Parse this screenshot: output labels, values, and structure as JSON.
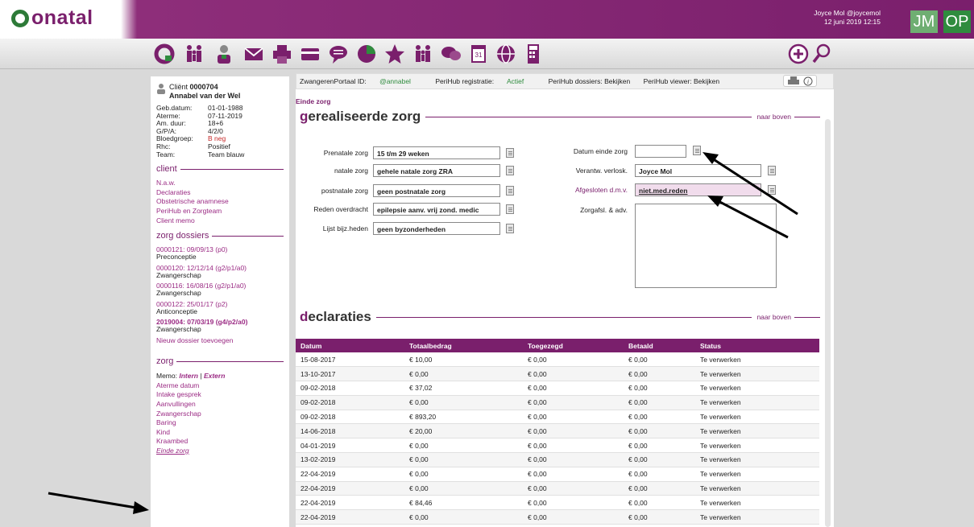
{
  "app": {
    "logo": "onatal",
    "user_line1": "Joyce Mol @joycemol",
    "user_line2": "12 juni 2019 12:15",
    "initials1": "JM",
    "initials2": "OP"
  },
  "toolbar": {
    "icons": [
      "onatal-icon",
      "family-icon",
      "person-icon",
      "mail-icon",
      "print-icon",
      "card-icon",
      "speech-bubble-icon",
      "pie-chart-icon",
      "star-icon",
      "family-icon",
      "chat-icon",
      "calendar-icon",
      "globe-icon",
      "calculator-icon"
    ],
    "add_icon": "plus-circle-icon",
    "search_icon": "search-icon"
  },
  "client": {
    "label": "Cliënt",
    "number": "0000704",
    "name": "Annabel van der Wel",
    "info": [
      [
        "Geb.datum:",
        "01-01-1988"
      ],
      [
        "Aterme:",
        "07-11-2019"
      ],
      [
        "Am. duur:",
        "18+6"
      ],
      [
        "G/P/A:",
        "4/2/0"
      ],
      [
        "Bloedgroep:",
        "B neg"
      ],
      [
        "Rhc:",
        "Positief"
      ],
      [
        "Team:",
        "Team blauw"
      ]
    ]
  },
  "sections": {
    "client": {
      "title": "client",
      "links": [
        "N.a.w.",
        "Declaraties",
        "Obstetrische anamnese",
        "PeriHub en Zorgteam",
        "Client memo"
      ]
    },
    "dossiers": {
      "title": "zorg dossiers",
      "items": [
        {
          "link": "0000121: 09/09/13 (p0)",
          "sub": "Preconceptie",
          "bold": false
        },
        {
          "link": "0000120: 12/12/14 (g2/p1/a0)",
          "sub": "Zwangerschap",
          "bold": false
        },
        {
          "link": "0000116: 16/08/16 (g2/p1/a0)",
          "sub": "Zwangerschap",
          "bold": false
        },
        {
          "link": "0000122: 25/01/17 (p2)",
          "sub": "Anticonceptie",
          "bold": false
        },
        {
          "link": "2019004: 07/03/19 (g4/p2/a0)",
          "sub": "Zwangerschap",
          "bold": true
        }
      ],
      "new": "Nieuw dossier toevoegen"
    },
    "zorg": {
      "title": "zorg",
      "memo_label": "Memo:",
      "memo_intern": "Intern",
      "memo_sep": "|",
      "memo_extern": "Extern",
      "links": [
        "Aterme datum",
        "Intake gesprek",
        "Aanvullingen",
        "Zwangerschap",
        "Baring",
        "Kind",
        "Kraambed",
        "Einde zorg"
      ]
    }
  },
  "main": {
    "hdr": {
      "portal_label": "ZwangerenPortaal ID:",
      "portal_value": "@annabel",
      "reg_label": "PeriHub registratie:",
      "reg_value": "Actief",
      "dossiers": "PeriHub dossiers: Bekijken",
      "viewer": "PeriHub viewer: Bekijken"
    },
    "breadcrumb": "Einde zorg",
    "title_first": "g",
    "title_rest": "erealiseerde zorg",
    "naar_boven": "naar boven",
    "fields": {
      "prenatal_label": "Prenatale zorg",
      "prenatal_value": "15 t/m 29 weken",
      "natal_label": "natale zorg",
      "natal_value": "gehele natale zorg ZRA",
      "postnatal_label": "postnatale zorg",
      "postnatal_value": "geen postnatale zorg",
      "reden_label": "Reden overdracht",
      "reden_value": "epilepsie aanv. vrij zond. medic",
      "lijst_label": "Lijst bijz.heden",
      "lijst_value": "geen byzonderheden",
      "datum_label": "Datum einde zorg",
      "datum_value": "",
      "verantw_label": "Verantw. verlosk.",
      "verantw_value": "Joyce Mol",
      "afgesloten_label": "Afgesloten d.m.v.",
      "afgesloten_value": "niet.med.reden",
      "zorgafsl_label": "Zorgafsl. & adv."
    },
    "decl_first": "d",
    "decl_rest": "eclaraties",
    "table": {
      "headers": [
        "Datum",
        "Totaalbedrag",
        "Toegezegd",
        "Betaald",
        "Status"
      ],
      "rows": [
        [
          "15-08-2017",
          "€ 10,00",
          "€ 0,00",
          "€ 0,00",
          "Te verwerken"
        ],
        [
          "13-10-2017",
          "€ 0,00",
          "€ 0,00",
          "€ 0,00",
          "Te verwerken"
        ],
        [
          "09-02-2018",
          "€ 37,02",
          "€ 0,00",
          "€ 0,00",
          "Te verwerken"
        ],
        [
          "09-02-2018",
          "€ 0,00",
          "€ 0,00",
          "€ 0,00",
          "Te verwerken"
        ],
        [
          "09-02-2018",
          "€ 893,20",
          "€ 0,00",
          "€ 0,00",
          "Te verwerken"
        ],
        [
          "14-06-2018",
          "€ 20,00",
          "€ 0,00",
          "€ 0,00",
          "Te verwerken"
        ],
        [
          "04-01-2019",
          "€ 0,00",
          "€ 0,00",
          "€ 0,00",
          "Te verwerken"
        ],
        [
          "13-02-2019",
          "€ 0,00",
          "€ 0,00",
          "€ 0,00",
          "Te verwerken"
        ],
        [
          "22-04-2019",
          "€ 0,00",
          "€ 0,00",
          "€ 0,00",
          "Te verwerken"
        ],
        [
          "22-04-2019",
          "€ 0,00",
          "€ 0,00",
          "€ 0,00",
          "Te verwerken"
        ],
        [
          "22-04-2019",
          "€ 84,46",
          "€ 0,00",
          "€ 0,00",
          "Te verwerken"
        ],
        [
          "22-04-2019",
          "€ 0,00",
          "€ 0,00",
          "€ 0,00",
          "Te verwerken"
        ]
      ]
    }
  },
  "colors": {
    "brand": "#7a1f6c",
    "green": "#2f8c3e",
    "red": "#c62828"
  }
}
